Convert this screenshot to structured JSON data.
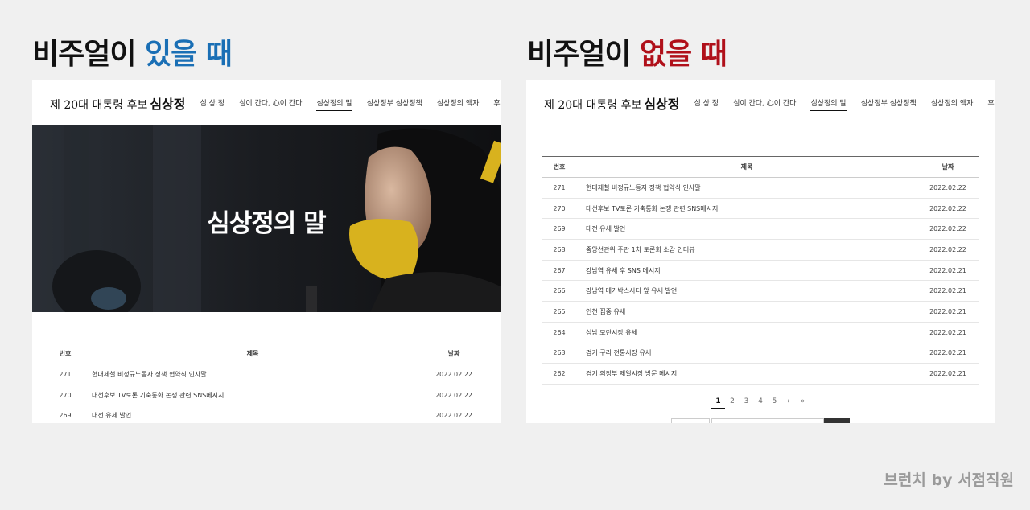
{
  "left_heading": {
    "prefix": "비주얼이 ",
    "accent": "있을 때"
  },
  "right_heading": {
    "prefix": "비주얼이 ",
    "accent": "없을 때"
  },
  "site": {
    "logo_prefix": "제 20대 대통령 후보",
    "logo_name": "심상정",
    "nav": [
      "심.상.정",
      "심이 간다, 心이 간다",
      "심상정의 말",
      "심상정부 심상정책",
      "심상정의 액자",
      "후원회"
    ],
    "active_nav": "심상정의 말"
  },
  "hero": {
    "title": "심상정의 말"
  },
  "board": {
    "headers": {
      "num": "번호",
      "title": "제목",
      "date": "날짜"
    },
    "rows": [
      {
        "num": "271",
        "title": "현대제철 비정규노동자 정책 협약식 인사말",
        "date": "2022.02.22"
      },
      {
        "num": "270",
        "title": "대선후보 TV토론 기축통화 논쟁 관련 SNS메시지",
        "date": "2022.02.22"
      },
      {
        "num": "269",
        "title": "대전 유세 발언",
        "date": "2022.02.22"
      },
      {
        "num": "268",
        "title": "중앙선관위 주관 1차 토론회 소감 인터뷰",
        "date": "2022.02.22"
      },
      {
        "num": "267",
        "title": "강남역 유세 후 SNS 메시지",
        "date": "2022.02.21"
      },
      {
        "num": "266",
        "title": "강남역 메가박스시티 앞 유세 발언",
        "date": "2022.02.21"
      },
      {
        "num": "265",
        "title": "인천 집중 유세",
        "date": "2022.02.21"
      },
      {
        "num": "264",
        "title": "성남 모란시장 유세",
        "date": "2022.02.21"
      },
      {
        "num": "263",
        "title": "경기 구리 전통시장 유세",
        "date": "2022.02.21"
      },
      {
        "num": "262",
        "title": "경기 의정부 제일시장 방문 메시지",
        "date": "2022.02.21"
      }
    ]
  },
  "pager": {
    "pages": [
      "1",
      "2",
      "3",
      "4",
      "5"
    ],
    "current": "1",
    "next": "›",
    "last": "»"
  },
  "credit": "브런치 by 서점직원",
  "colors": {
    "accent_blue": "#1a6fb5",
    "accent_red": "#b0101a",
    "mask_yellow": "#d8b21e"
  }
}
